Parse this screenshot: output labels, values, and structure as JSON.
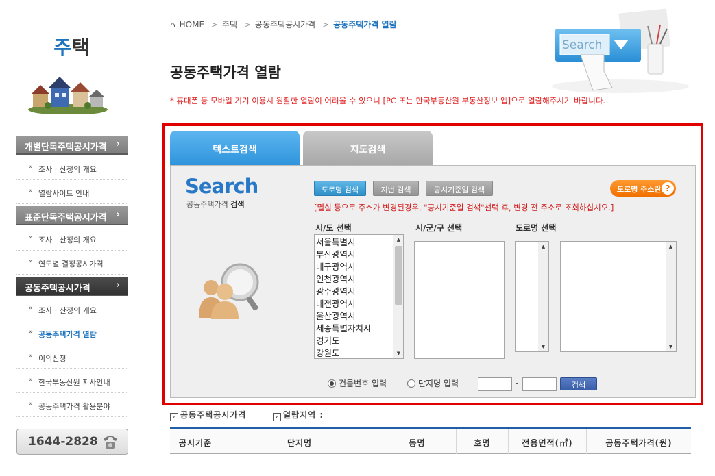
{
  "sidebar": {
    "title_accent": "주",
    "title_rest": "택",
    "categories": [
      {
        "label": "개별단독주택공시가격",
        "chev": "›",
        "subs": [
          {
            "label": "조사 · 산정의 개요"
          },
          {
            "label": "열람사이트 안내"
          }
        ]
      },
      {
        "label": "표준단독주택공시가격",
        "chev": "›",
        "subs": [
          {
            "label": "조사 · 산정의 개요"
          },
          {
            "label": "연도별 결정공시가격"
          }
        ]
      },
      {
        "label": "공동주택공시가격",
        "chev": "›",
        "subs": [
          {
            "label": "조사 · 산정의 개요"
          },
          {
            "label": "공동주택가격 열람"
          },
          {
            "label": "이의신청"
          },
          {
            "label": "한국부동산원 지사안내"
          },
          {
            "label": "공동주택가격 활용분야"
          }
        ]
      }
    ],
    "sub_bullet": "»",
    "phone": "1644-2828"
  },
  "breadcrumb": {
    "home": "HOME",
    "sep": ">",
    "items": [
      "주택",
      "공동주택공시가격",
      "공동주택가격 열람"
    ]
  },
  "page_title": "공동주택가격 열람",
  "notice": "* 휴대폰 등 모바일 기기 이용시 원활한 열람이 어려울 수 있으니 [PC 또는 한국부동산원 부동산정보 앱]으로 열람해주시기 바랍니다.",
  "header_illustration": {
    "search_word": "Search"
  },
  "tabs": {
    "text_search": "텍스트검색",
    "map_search": "지도검색"
  },
  "search": {
    "logo": "Search",
    "sub_a": "공동주택가격",
    "sub_b": "검색",
    "btn_road": "도로명 검색",
    "btn_lot": "지번 검색",
    "btn_date": "공시기준일 검색",
    "btn_help": "도로명 주소란",
    "help_q": "?",
    "warning": "[멸실 등으로 주소가 변경된경우, \"공시기준일 검색\"선택 후, 변경 전 주소로 조회하십시오.]",
    "label_sido": "시/도 선택",
    "label_sigungu": "시/군/구 선택",
    "label_road": "도로명 선택",
    "sido_options": [
      "서울특별시",
      "부산광역시",
      "대구광역시",
      "인천광역시",
      "광주광역시",
      "대전광역시",
      "울산광역시",
      "세종특별자치시",
      "경기도",
      "강원도"
    ],
    "radio_building": "건물번호 입력",
    "radio_complex": "단지명 입력",
    "dash": "-",
    "btn_search": "검색"
  },
  "results": {
    "label_price": "공동주택공시가격",
    "label_region": "열람지역 :",
    "box_glyph": "›",
    "columns": [
      "공시기준",
      "단지명",
      "동명",
      "호명",
      "전용면적(㎡)",
      "공동주택가격(원)"
    ]
  },
  "colors": {
    "accent": "#1e73be",
    "highlight_frame": "#e00000",
    "notice": "#e02020"
  }
}
